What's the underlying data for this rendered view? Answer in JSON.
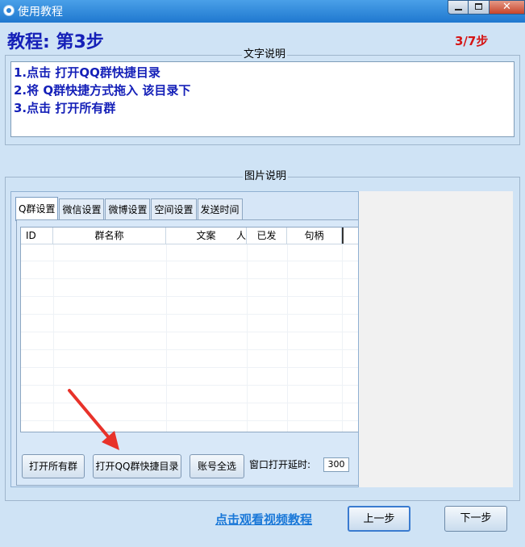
{
  "window": {
    "title": "使用教程",
    "controls": {
      "minimize": "minimize-icon",
      "maximize": "maximize-icon",
      "close": "close-icon"
    }
  },
  "header": {
    "step_title": "教程: 第3步",
    "step_count": "3/7步"
  },
  "text_section": {
    "legend": "文字说明",
    "lines": [
      "1.点击 打开QQ群快捷目录",
      "2.将 Q群快捷方式拖入 该目录下",
      "3.点击 打开所有群"
    ]
  },
  "image_section": {
    "legend": "图片说明",
    "tabs": [
      "Q群设置",
      "微信设置",
      "微博设置",
      "空间设置",
      "发送时间"
    ],
    "active_tab": 0,
    "columns": [
      "ID",
      "群名称",
      "文案",
      "人",
      "已发",
      "句柄"
    ],
    "buttons": {
      "open_all": "打开所有群",
      "open_qq_dir": "打开QQ群快捷目录",
      "select_all": "账号全选"
    },
    "delay_label": "窗口打开延时:",
    "delay_value": "300"
  },
  "footer": {
    "video_link": "点击观看视频教程",
    "prev": "上一步",
    "next": "下一步"
  },
  "colors": {
    "accent": "#1520b8",
    "step_count": "#d51515",
    "link": "#1a78d8",
    "arrow": "#e8322a"
  }
}
